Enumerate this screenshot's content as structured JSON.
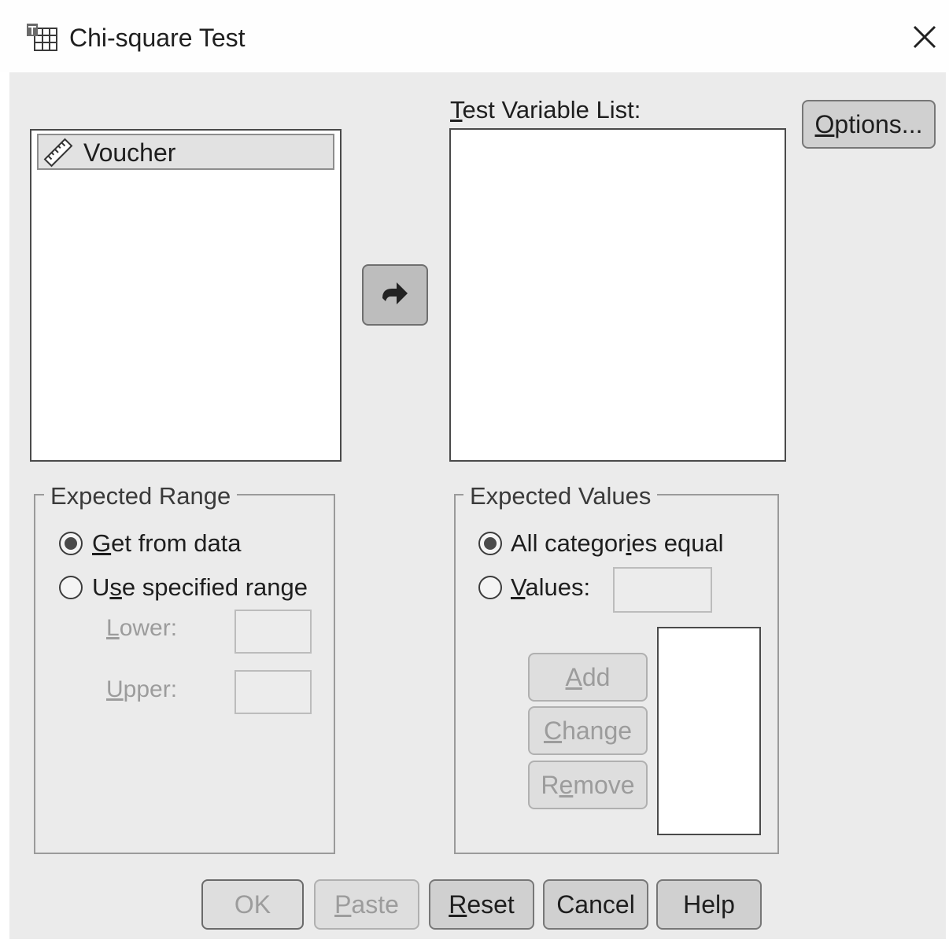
{
  "window": {
    "title": "Chi-square Test",
    "icon": "chi-square-dialog-icon",
    "close_icon": "close-icon"
  },
  "source_list": {
    "items": [
      {
        "label": "Voucher",
        "icon": "scale-variable-ruler-icon"
      }
    ]
  },
  "move_button": {
    "icon": "right-arrow-icon"
  },
  "test_variable_list": {
    "label_mnemonic": "T",
    "label_rest": "est Variable List:",
    "items": []
  },
  "options_button": {
    "mnemonic": "O",
    "rest": "ptions..."
  },
  "expected_range": {
    "legend": "Expected Range",
    "get_from_data": {
      "mnemonic": "G",
      "rest": "et from data",
      "selected": true
    },
    "use_specified_range": {
      "pre": "U",
      "mnemonic": "s",
      "rest": "e specified range",
      "selected": false
    },
    "lower": {
      "pre": "",
      "mnemonic": "L",
      "rest": "ower:",
      "value": ""
    },
    "upper": {
      "pre": "",
      "mnemonic": "U",
      "rest": "pper:",
      "value": ""
    }
  },
  "expected_values": {
    "legend": "Expected Values",
    "all_categories_equal": {
      "pre": "All categor",
      "mnemonic": "i",
      "rest": "es equal",
      "selected": true
    },
    "values_option": {
      "mnemonic": "V",
      "rest": "alues:",
      "selected": false,
      "value": ""
    },
    "add_button": {
      "mnemonic": "A",
      "rest": "dd"
    },
    "change_button": {
      "mnemonic": "C",
      "rest": "hange"
    },
    "remove_button": {
      "pre": "R",
      "mnemonic": "e",
      "rest": "move"
    },
    "values_list": []
  },
  "footer": {
    "ok": "OK",
    "paste": {
      "mnemonic": "P",
      "rest": "aste"
    },
    "reset": {
      "mnemonic": "R",
      "rest": "eset"
    },
    "cancel": "Cancel",
    "help": "Help"
  }
}
